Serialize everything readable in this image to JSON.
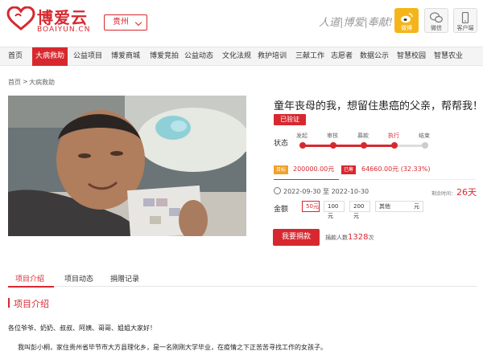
{
  "header": {
    "logo_cn": "博爱云",
    "logo_en": "BOAIYUN.CN",
    "region": "贵州",
    "slogan": "人道|博爱|奉献!",
    "weibo_label": "微博",
    "wechat_label": "微信",
    "mobile_label": "客户端",
    "brand_color": "#d7282f"
  },
  "nav": {
    "items": [
      "首页",
      "大病救助",
      "公益项目",
      "博爱商城",
      "博爱竞拍",
      "公益动态",
      "文化法规",
      "救护培训",
      "三献工作",
      "志愿者",
      "数据公示",
      "智慧校园",
      "智慧农业"
    ],
    "active": "大病救助"
  },
  "breadcrumb": {
    "home": "首页",
    "sep": ">",
    "current": "大病救助"
  },
  "project": {
    "title": "童年丧母的我，想留住患癌的父亲，帮帮我！",
    "verified": "已验证",
    "status_label": "状态",
    "steps": [
      "发起",
      "审核",
      "募款",
      "执行",
      "结束"
    ],
    "current_step": "执行",
    "target_label": "目标",
    "target_value": "200000.00元",
    "raised_label": "已筹",
    "raised_value": "64660.00元 (32.33%)",
    "progress_percent": 32.33,
    "date_range": "2022-09-30 至 2022-10-30",
    "remaining_label": "剩余时间：",
    "remaining_value": "26天",
    "amount_label": "金额",
    "amount_options": [
      "50元",
      "100元",
      "200元"
    ],
    "selected_amount": "50元",
    "other_label": "其他",
    "other_unit": "元",
    "donate_button": "我要捐款",
    "donors_label": "捐款人数",
    "donors_count": "1328",
    "donors_unit": "次"
  },
  "tabs": {
    "items": [
      "项目介绍",
      "项目动态",
      "捐赠记录"
    ],
    "active": "项目介绍"
  },
  "section": {
    "title": "项目介绍",
    "paragraphs": [
      "各位爷爷、奶奶、叔叔、阿姨、哥哥、姐姐大家好！",
      "我叫彭小桐，家住贵州省毕节市大方县理化乡，是一名刚刚大学毕业，在疫情之下正苦苦寻找工作的女孩子。"
    ]
  }
}
